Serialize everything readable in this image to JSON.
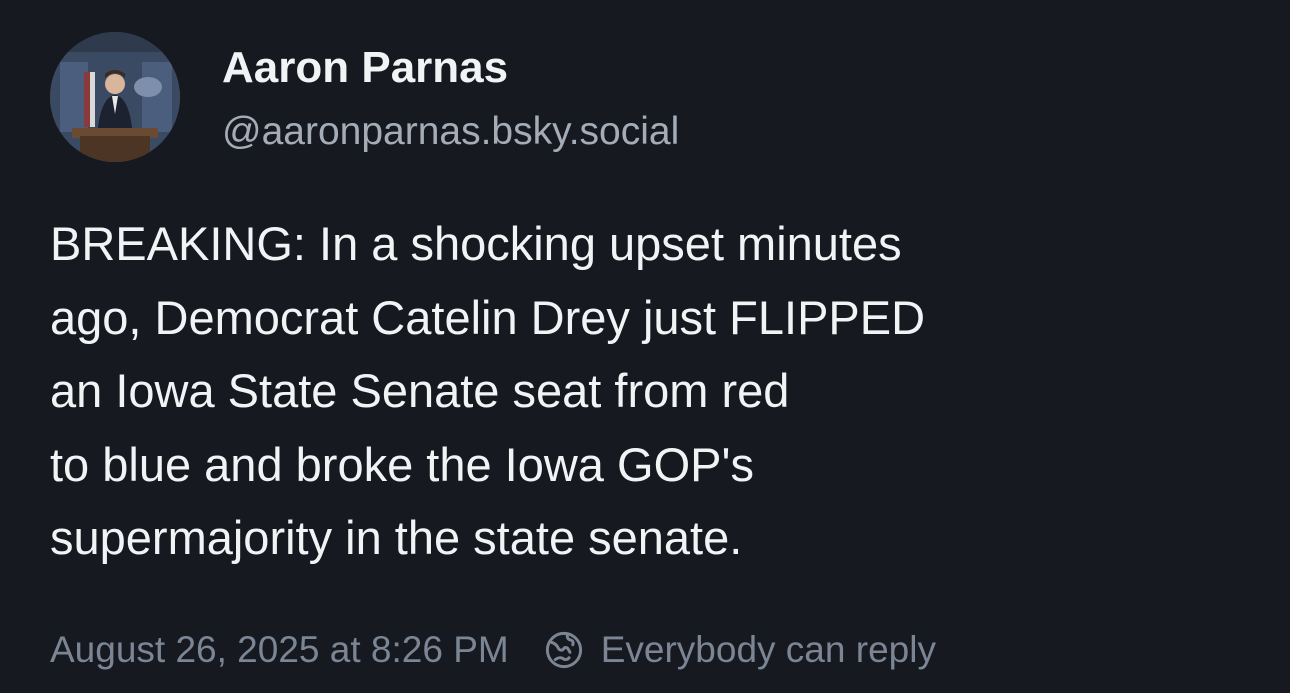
{
  "author": {
    "display_name": "Aaron Parnas",
    "handle": "@aaronparnas.bsky.social",
    "avatar": "press-briefing-room-avatar"
  },
  "post": {
    "text": "BREAKING: In a shocking upset minutes\nago, Democrat Catelin Drey just FLIPPED\nan Iowa State Senate seat from red\nto blue and broke the Iowa GOP's\nsupermajority in the state senate.",
    "timestamp": "August 26, 2025 at 8:26 PM",
    "reply_setting": "Everybody can reply",
    "reply_setting_icon": "earth-globe-icon"
  },
  "colors": {
    "background": "#161a20",
    "text_primary": "#f1f3f5",
    "text_secondary": "#a4acb8",
    "text_muted": "#7b8594"
  }
}
